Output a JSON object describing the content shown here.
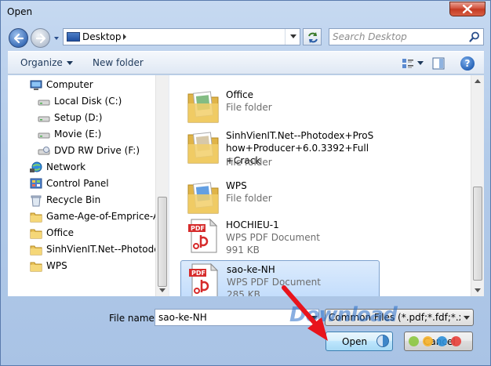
{
  "window": {
    "title": "Open"
  },
  "address": {
    "location": "Desktop"
  },
  "search": {
    "placeholder": "Search Desktop"
  },
  "toolbar": {
    "organize_label": "Organize",
    "new_folder_label": "New folder",
    "help_label": "?"
  },
  "nav_items": [
    {
      "label": "Computer",
      "icon": "computer-icon"
    },
    {
      "label": "Local Disk (C:)",
      "icon": "drive-icon"
    },
    {
      "label": "Setup (D:)",
      "icon": "drive-icon"
    },
    {
      "label": "Movie  (E:)",
      "icon": "drive-icon"
    },
    {
      "label": "DVD RW Drive (F:)",
      "icon": "dvd-drive-icon"
    },
    {
      "label": "Network",
      "icon": "network-icon"
    },
    {
      "label": "Control Panel",
      "icon": "control-panel-icon"
    },
    {
      "label": "Recycle Bin",
      "icon": "recycle-bin-icon"
    },
    {
      "label": "Game-Age-of-Emprice-Ac",
      "icon": "folder-icon"
    },
    {
      "label": "Office",
      "icon": "folder-icon"
    },
    {
      "label": "SinhVienIT.Net--Photodex",
      "icon": "folder-icon"
    },
    {
      "label": "WPS",
      "icon": "folder-icon"
    }
  ],
  "files": [
    {
      "name": "Office",
      "type": "File folder",
      "size": "",
      "icon": "folder-icon"
    },
    {
      "name": "SinhVienIT.Net--Photodex+ProShow+Producer+6.0.3392+Full+Crack",
      "type": "File folder",
      "size": "",
      "icon": "folder-icon"
    },
    {
      "name": "WPS",
      "type": "File folder",
      "size": "",
      "icon": "folder-icon"
    },
    {
      "name": "HOCHIEU-1",
      "type": "WPS PDF Document",
      "size": "991 KB",
      "icon": "pdf-icon"
    },
    {
      "name": "sao-ke-NH",
      "type": "WPS PDF Document",
      "size": "285 KB",
      "icon": "pdf-icon"
    }
  ],
  "bottom": {
    "file_name_label": "File name:",
    "file_name_value": "sao-ke-NH",
    "filter_value": "Common Files (*.pdf;*.fdf;*.xfdf",
    "open_label": "Open",
    "cancel_label": "Cancel"
  },
  "watermark": "Download",
  "colors": {
    "selection": "#c1dcfc",
    "accent": "#3c7fb1",
    "arrow": "#e8141c"
  }
}
